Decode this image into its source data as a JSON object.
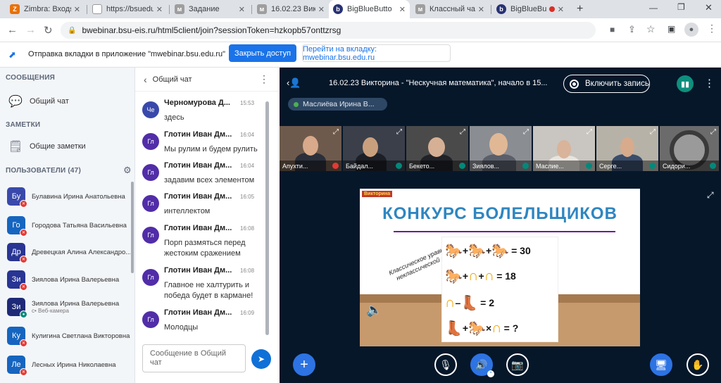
{
  "browser": {
    "tabs": [
      {
        "title": "Zimbra: Входящ",
        "icon": "zimbra-icon",
        "color": "#e8710a"
      },
      {
        "title": "https://bsuedu",
        "icon": "page-icon",
        "color": "#5f6368"
      },
      {
        "title": "Задание",
        "icon": "moodle-icon",
        "color": "#5f6368"
      },
      {
        "title": "16.02.23 Викто",
        "icon": "moodle-icon",
        "color": "#5f6368"
      },
      {
        "title": "BigBlueButto",
        "icon": "bbb-icon",
        "color": "#283274"
      },
      {
        "title": "Классный час",
        "icon": "moodle-icon",
        "color": "#5f6368"
      },
      {
        "title": "BigBlueBut",
        "icon": "bbb-icon",
        "color": "#283274"
      }
    ],
    "new_tab": "+",
    "url": "bwebinar.bsu-eis.ru/html5client/join?sessionToken=hzkopb57onttzrsg"
  },
  "infobar": {
    "message": "Отправка вкладки в приложение \"mwebinar.bsu.edu.ru\"",
    "primary_button": "Закрыть доступ",
    "secondary_button": "Перейти на вкладку: mwebinar.bsu.edu.ru"
  },
  "sidebar": {
    "messages_header": "СООБЩЕНИЯ",
    "public_chat": "Общий чат",
    "notes_header": "ЗАМЕТКИ",
    "shared_notes": "Общие заметки",
    "users_header": "ПОЛЬЗОВАТЕЛИ (47)",
    "users": [
      {
        "initials": "Бу",
        "name": "Булавина Ирина Анатольевна",
        "sub": "",
        "mic": "muted",
        "color": "#3949ab"
      },
      {
        "initials": "Го",
        "name": "Городова Татьяна Васильевна",
        "sub": "",
        "mic": "muted",
        "color": "#1565c0"
      },
      {
        "initials": "Др",
        "name": "Древецкая Алина Александро...",
        "sub": "",
        "mic": "muted",
        "color": "#283593"
      },
      {
        "initials": "Зи",
        "name": "Зиялова Ирина Валерьевна",
        "sub": "",
        "mic": "muted",
        "color": "#283593"
      },
      {
        "initials": "Зи",
        "name": "Зиялова Ирина Валерьевна",
        "sub": "с• Веб-камера",
        "mic": "on",
        "color": "#1e2a78"
      },
      {
        "initials": "Ку",
        "name": "Кулигина Светлана Викторовна",
        "sub": "",
        "mic": "muted",
        "color": "#1565c0"
      },
      {
        "initials": "Ле",
        "name": "Лесных Ирина Николаевна",
        "sub": "",
        "mic": "muted",
        "color": "#1565c0"
      }
    ]
  },
  "chat": {
    "title": "Общий чат",
    "messages": [
      {
        "initials": "Че",
        "name": "Черномурова Д...",
        "time": "15:53",
        "text": "здесь"
      },
      {
        "initials": "Гл",
        "name": "Глотин Иван Дм...",
        "time": "16:04",
        "text": "Мы рулим и будем рулить"
      },
      {
        "initials": "Гл",
        "name": "Глотин Иван Дм...",
        "time": "16:04",
        "text": "задавим всех элементом"
      },
      {
        "initials": "Гл",
        "name": "Глотин Иван Дм...",
        "time": "16:05",
        "text": "интеллектом"
      },
      {
        "initials": "Гл",
        "name": "Глотин Иван Дм...",
        "time": "16:08",
        "text": "Порп размяться перед жестоким сражением"
      },
      {
        "initials": "Гл",
        "name": "Глотин Иван Дм...",
        "time": "16:08",
        "text": "Главное не халтурить и победа будет в кармане!"
      },
      {
        "initials": "Гл",
        "name": "Глотин Иван Дм...",
        "time": "16:09",
        "text": "Молодцы"
      }
    ],
    "input_placeholder": "Сообщение в Общий чат"
  },
  "meeting": {
    "title": "16.02.23 Викторина - \"Нескучная математика\", начало в 15...",
    "record_button": "Включить запись",
    "talker": "Маслиёва Ирина В...",
    "cameras": [
      {
        "name": "Апухти...",
        "mic": "muted"
      },
      {
        "name": "Байдал...",
        "mic": "on"
      },
      {
        "name": "Бекето...",
        "mic": "on"
      },
      {
        "name": "Зиялов...",
        "mic": "on"
      },
      {
        "name": "Маслие...",
        "mic": "on"
      },
      {
        "name": "Серге...",
        "mic": "on"
      },
      {
        "name": "Сидори...",
        "mic": "on"
      }
    ],
    "slide": {
      "tag": "Викторина",
      "title": "КОНКУРС БОЛЕЛЬЩИКОВ",
      "subtitle": "Классическое уравнение в неклассической форме",
      "eq1_result": "= 30",
      "eq2_result": "= 18",
      "eq3_result": "= 2",
      "eq4_result": "= ?"
    }
  }
}
